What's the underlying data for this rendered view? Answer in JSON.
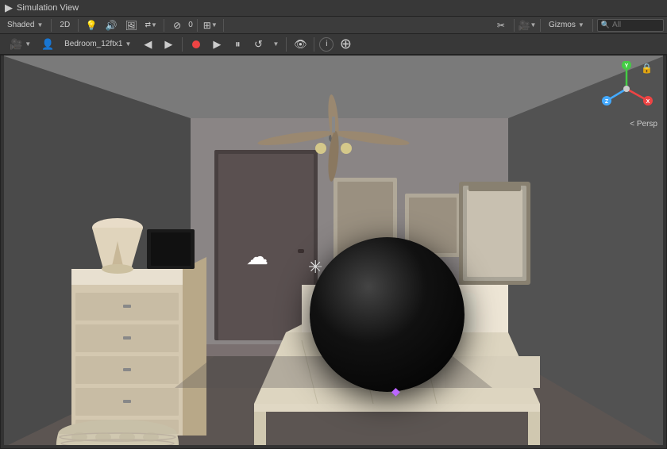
{
  "titlebar": {
    "title": "Simulation View",
    "icon": "▶"
  },
  "toolbar": {
    "shading": "Shaded",
    "view2d": "2D",
    "search_placeholder": "All",
    "gizmos_label": "Gizmos",
    "icons": [
      "🔦",
      "🔊",
      "🖼",
      "↕",
      "⊘",
      "⊞"
    ],
    "transform_icons": [
      "✂",
      "🎥",
      "▼"
    ]
  },
  "playbar": {
    "camera_label": "Bedroom_12ftx1",
    "scene_label": "Bedroom_12ftx1",
    "icons": [
      "🎥",
      "👤"
    ],
    "buttons": [
      "◀",
      "▶",
      "▶▶",
      "↺"
    ],
    "extra_icons": [
      "👁",
      "ℹ",
      "⊕"
    ]
  },
  "viewport": {
    "persp_label": "< Persp",
    "gizmo_axes": {
      "x": "#e44",
      "y": "#4c4",
      "z": "#44e",
      "labels": {
        "x": "X",
        "y": "Y",
        "z": "Z"
      }
    },
    "scene_elements": {
      "cloud_icon": "☁",
      "sun_icon": "✳",
      "diamond_icon": "◆"
    }
  }
}
